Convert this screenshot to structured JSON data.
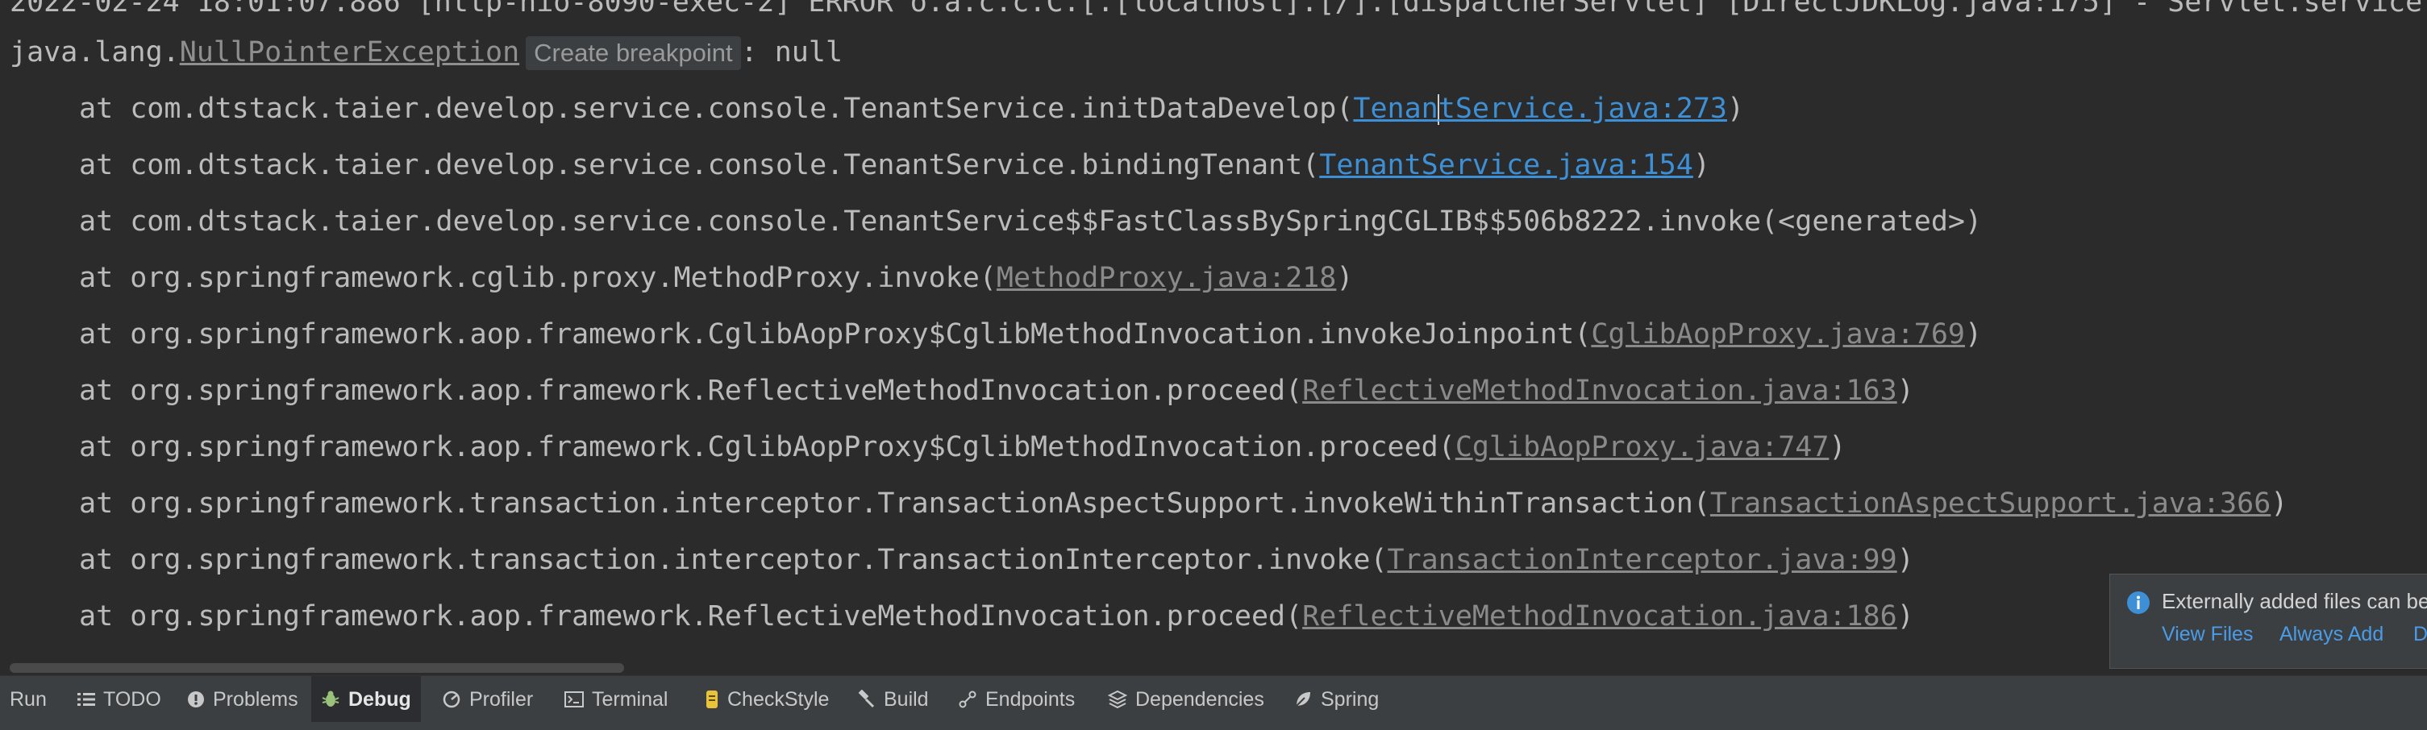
{
  "console": {
    "top_partial": "2022-02-24 18:01:07.886 [http-nio-8090-exec-2] ERROR o.a.c.c.C.[.[localhost].[/].[dispatcherServlet] [DirectJDKLog.java:175] - Servlet.service",
    "exception": {
      "prefix": "java.lang.",
      "class_name": "NullPointerException",
      "breakpoint_label": "Create breakpoint",
      "suffix": ": null"
    },
    "frames": [
      {
        "method": "at com.dtstack.taier.develop.service.console.TenantService.initDataDevelop(",
        "link_a": "Tenan",
        "link_b": "tService.java:273",
        "close": ")"
      },
      {
        "method": "at com.dtstack.taier.develop.service.console.TenantService.bindingTenant(",
        "link": "TenantService.java:154",
        "close": ")"
      },
      {
        "text": "at com.dtstack.taier.develop.service.console.TenantService$$FastClassBySpringCGLIB$$506b8222.invoke(<generated>)"
      },
      {
        "method": "at org.springframework.cglib.proxy.MethodProxy.invoke(",
        "link": "MethodProxy.java:218",
        "close": ")"
      },
      {
        "method": "at org.springframework.aop.framework.CglibAopProxy$CglibMethodInvocation.invokeJoinpoint(",
        "link": "CglibAopProxy.java:769",
        "close": ")"
      },
      {
        "method": "at org.springframework.aop.framework.ReflectiveMethodInvocation.proceed(",
        "link": "ReflectiveMethodInvocation.java:163",
        "close": ")"
      },
      {
        "method": "at org.springframework.aop.framework.CglibAopProxy$CglibMethodInvocation.proceed(",
        "link": "CglibAopProxy.java:747",
        "close": ")"
      },
      {
        "method": "at org.springframework.transaction.interceptor.TransactionAspectSupport.invokeWithinTransaction(",
        "link": "TransactionAspectSupport.java:366",
        "close": ")"
      },
      {
        "method": "at org.springframework.transaction.interceptor.TransactionInterceptor.invoke(",
        "link": "TransactionInterceptor.java:99",
        "close": ")"
      },
      {
        "method": "at org.springframework.aop.framework.ReflectiveMethodInvocation.proceed(",
        "link": "ReflectiveMethodInvocation.java:186",
        "close": ")"
      }
    ]
  },
  "toolbar": {
    "items": [
      "Run",
      "TODO",
      "Problems",
      "Debug",
      "Profiler",
      "Terminal",
      "CheckStyle",
      "Build",
      "Endpoints",
      "Dependencies",
      "Spring"
    ],
    "active": "Debug"
  },
  "notification": {
    "message": "Externally added files can be",
    "actions": [
      "View Files",
      "Always Add",
      "D"
    ]
  },
  "colors": {
    "background": "#2b2b2b",
    "text": "#bbbbbb",
    "link_project": "#3d8fd6",
    "link_library": "#8a8a8a",
    "toolbar": "#3c3f41",
    "info": "#3d8fd6"
  },
  "icons": [
    "list-icon",
    "info-circle-icon",
    "bug-icon",
    "profiler-icon",
    "terminal-icon",
    "checkstyle-icon",
    "hammer-icon",
    "endpoints-icon",
    "dependencies-icon",
    "spring-leaf-icon"
  ]
}
